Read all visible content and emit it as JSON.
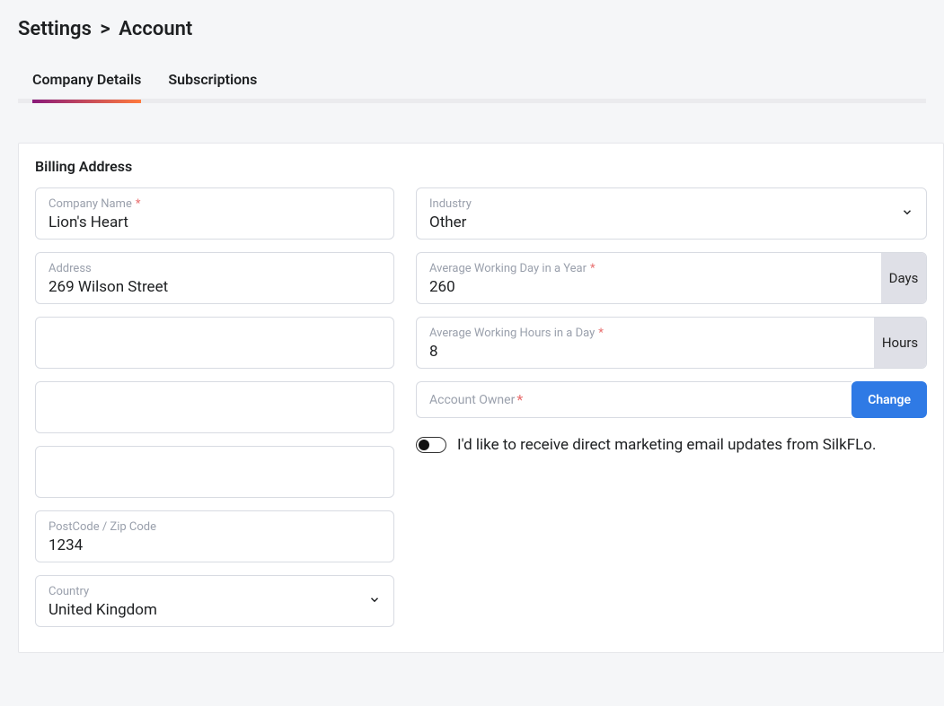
{
  "breadcrumb": {
    "a": "Settings",
    "sep": ">",
    "b": "Account"
  },
  "tabs": {
    "company": "Company Details",
    "subs": "Subscriptions"
  },
  "section_title": "Billing Address",
  "fields": {
    "company_name": {
      "label": "Company Name",
      "value": "Lion's Heart"
    },
    "address": {
      "label": "Address",
      "value": "269 Wilson Street"
    },
    "addr2": {
      "value": ""
    },
    "addr3": {
      "value": ""
    },
    "addr4": {
      "value": ""
    },
    "postcode": {
      "label": "PostCode / Zip Code",
      "value": "1234"
    },
    "country": {
      "label": "Country",
      "value": "United Kingdom"
    },
    "industry": {
      "label": "Industry",
      "value": "Other"
    },
    "avg_days": {
      "label": "Average Working Day in a Year",
      "value": "260",
      "suffix": "Days"
    },
    "avg_hours": {
      "label": "Average Working Hours in a Day",
      "value": "8",
      "suffix": "Hours"
    },
    "owner": {
      "label": "Account Owner",
      "change": "Change"
    }
  },
  "marketing_text": "I'd like to receive direct marketing email updates from SilkFLo."
}
